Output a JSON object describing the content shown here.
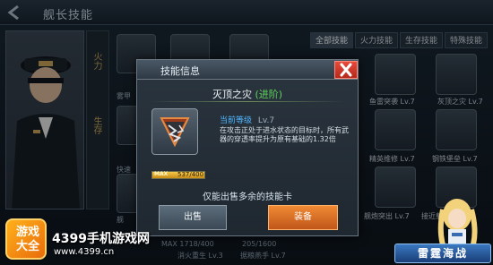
{
  "background": {
    "page_title": "舰长技能",
    "strip_labels": [
      "火力",
      "生存"
    ],
    "cells": [
      {
        "label": "雾甲"
      },
      {
        "label": "快速"
      },
      {
        "label": "舰"
      }
    ],
    "tabs": [
      {
        "label": "全部技能",
        "active": true
      },
      {
        "label": "火力技能",
        "active": false
      },
      {
        "label": "生存技能",
        "active": false
      },
      {
        "label": "特殊技能",
        "active": false
      }
    ],
    "right_cells": [
      {
        "label": "鱼雷突袭 Lv.7"
      },
      {
        "label": "灰顶之灾 Lv.7"
      },
      {
        "label": "精英维修 Lv.7"
      },
      {
        "label": "钢铁堡垒 Lv.7"
      },
      {
        "label": "舰炮突出 Lv.7"
      },
      {
        "label": "接近射击 Lv.7"
      }
    ],
    "bottom_texts": [
      "MAX 1718/400",
      "205/1600",
      "消火重生 Lv.3",
      "据粮燕手 Lv.7"
    ]
  },
  "watermark": {
    "logo_line1": "游戏",
    "logo_line2": "大全",
    "site_name": "4399手机游戏网",
    "site_url": "www.4399.cn",
    "game_logo": "雷霆海战"
  },
  "modal": {
    "title": "技能信息",
    "skill_name": "灭顶之灾",
    "skill_tag": "(进阶)",
    "level_label": "当前等级",
    "level_value": "Lv.7",
    "description": "在攻击正处于进水状态的目标时，所有武器的穿透率提升为原有基础的1.32倍",
    "progress": {
      "max_label": "MAX",
      "text": "537/400",
      "fraction": 1.0
    },
    "sell_hint": "仅能出售多余的技能卡",
    "sell_button": "出售",
    "equip_button": "装备"
  },
  "colors": {
    "accent_orange": "#e8742a",
    "close_red": "#d23a2c",
    "level_blue": "#4fb6ff",
    "tag_green": "#5fd35c"
  }
}
